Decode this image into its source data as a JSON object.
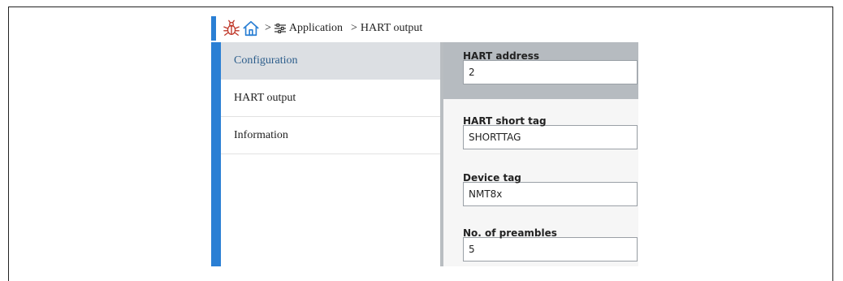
{
  "breadcrumb": {
    "sep1": ">",
    "application_label": "Application",
    "sep2": ">",
    "current_label": "HART output"
  },
  "menu": {
    "items": [
      {
        "label": "Configuration",
        "active": true
      },
      {
        "label": "HART output",
        "active": false
      },
      {
        "label": "Information",
        "active": false
      }
    ]
  },
  "fields": [
    {
      "label": "HART address",
      "value": "2"
    },
    {
      "label": "HART short tag",
      "value": "SHORTTAG"
    },
    {
      "label": "Device tag",
      "value": "NMT8x"
    },
    {
      "label": "No. of preambles",
      "value": "5"
    }
  ],
  "colors": {
    "accent": "#2a7fd4",
    "bug_icon": "#c0392b",
    "home_icon": "#2a7fd4",
    "active_item_bg": "#dcdfe3",
    "highlight_field_bg": "#b6bbc0"
  },
  "icons": {
    "bug": "bug-icon",
    "home": "home-icon",
    "application": "filter-settings-icon"
  }
}
